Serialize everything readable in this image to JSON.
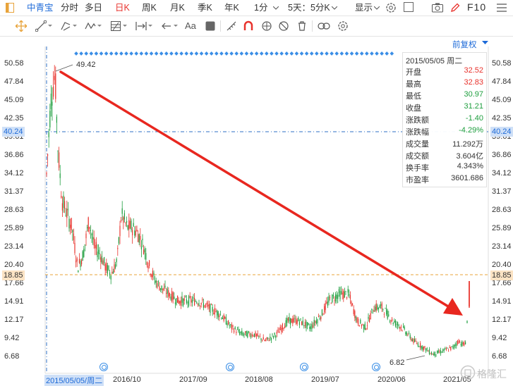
{
  "toolbar": {
    "stock_name": "中青宝",
    "periods": [
      "分时",
      "多日",
      "日K",
      "周K",
      "月K",
      "季K",
      "年K",
      "1分"
    ],
    "active_period": "日K",
    "multi_period": "5天：5分K",
    "display_label": "显示",
    "f10_label": "F10"
  },
  "draw_tools": {
    "text_tool_label": "Aa"
  },
  "adjust_label": "前复权",
  "y_axis": {
    "labels": [
      "50.58",
      "47.84",
      "45.09",
      "42.35",
      "39.61",
      "36.86",
      "34.12",
      "31.37",
      "28.63",
      "25.89",
      "23.14",
      "20.40",
      "17.66",
      "14.91",
      "12.17",
      "9.42",
      "6.68"
    ],
    "crosshair_value": "40.24",
    "ref_value": "18.85"
  },
  "x_axis": {
    "cursor_label": "2015/05/05/周二",
    "labels": [
      "2016/10",
      "2017/09",
      "2018/08",
      "2019/07",
      "2020/06",
      "2021/05"
    ]
  },
  "annotations": {
    "high_label": "49.42",
    "low_label": "6.82"
  },
  "tooltip": {
    "header": "2015/05/05 周二",
    "rows": [
      {
        "key": "开盘",
        "value": "32.52",
        "color": "#e8322c"
      },
      {
        "key": "最高",
        "value": "32.83",
        "color": "#e8322c"
      },
      {
        "key": "最低",
        "value": "30.97",
        "color": "#1e9e3e"
      },
      {
        "key": "收盘",
        "value": "31.21",
        "color": "#1e9e3e"
      },
      {
        "key": "涨跌额",
        "value": "-1.40",
        "color": "#1e9e3e"
      },
      {
        "key": "涨跌幅",
        "value": "-4.29%",
        "color": "#1e9e3e"
      },
      {
        "key": "成交量",
        "value": "11.292万",
        "color": "#333333"
      },
      {
        "key": "成交额",
        "value": "3.604亿",
        "color": "#333333"
      },
      {
        "key": "换手率",
        "value": "4.343%",
        "color": "#333333"
      },
      {
        "key": "市盈率",
        "value": "3601.686",
        "color": "#333333"
      }
    ]
  },
  "watermark": "格隆汇",
  "colors": {
    "up": "#e8322c",
    "down": "#1e9e3e",
    "accent": "#1d6ad8",
    "arrow": "#e8271f"
  }
}
